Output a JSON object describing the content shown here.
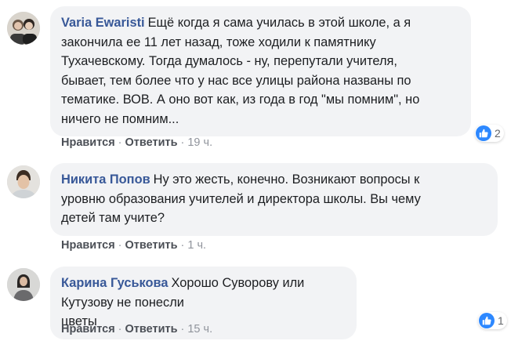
{
  "comments": [
    {
      "author": "Varia Ewaristi",
      "text": "Ещё когда я сама училась в этой школе, а я\nзакончила ее 11 лет назад, тоже ходили к памятнику\nТухачевскому. Тогда думалось - ну, перепутали учителя,\nбывает, тем более что у нас все улицы района названы по\nтематике. ВОВ. А оно вот как, из года в год \"мы помним\", но\nничего не помним...",
      "like_label": "Нравится",
      "reply_label": "Ответить",
      "time": "19 ч.",
      "reactions": "2"
    },
    {
      "author": "Никита Попов",
      "text": "Ну это жесть, конечно. Возникают вопросы к\nуровню образования учителей и директора школы. Вы чему\nдетей там учите?",
      "like_label": "Нравится",
      "reply_label": "Ответить",
      "time": "1 ч."
    },
    {
      "author": "Карина Гуськова",
      "text": "Хорошо Суворову или Кутузову не понесли\nцветы",
      "like_label": "Нравится",
      "reply_label": "Ответить",
      "time": "15 ч.",
      "reactions": "1"
    }
  ],
  "icons": {
    "reaction": "like-thumb-icon"
  },
  "colors": {
    "author": "#385898",
    "bubble": "#f2f3f5",
    "like": "#2d88ff",
    "meta": "#90949c"
  },
  "separator": "·"
}
